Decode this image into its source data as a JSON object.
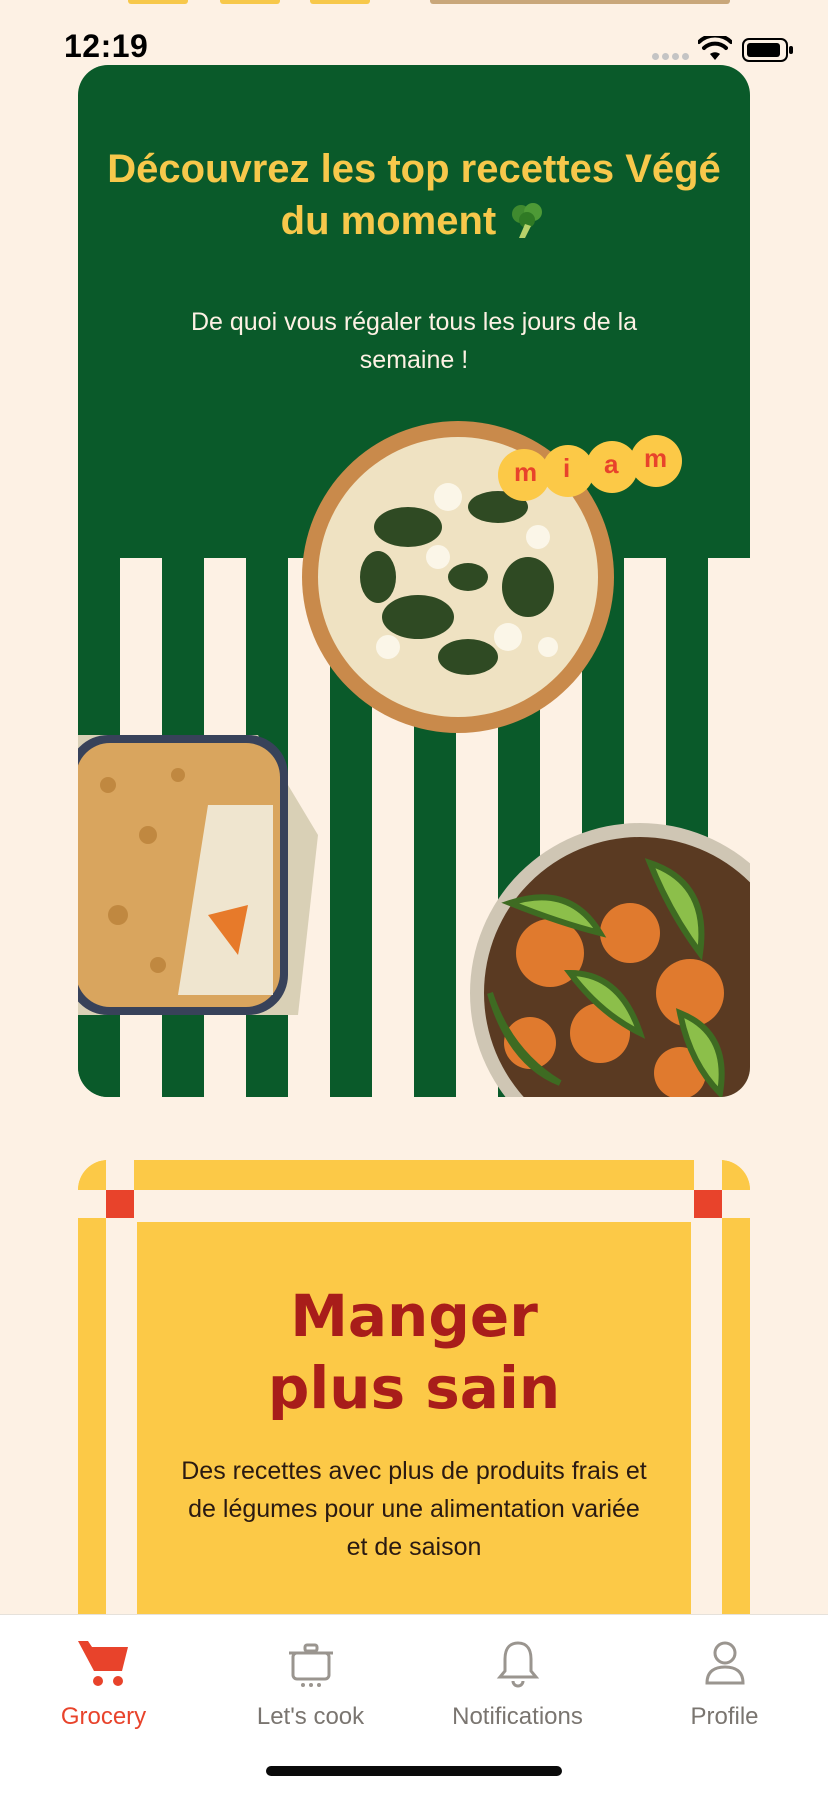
{
  "status_bar": {
    "time": "12:19"
  },
  "promo_vege": {
    "title": "Découvrez les top recettes Végé du moment",
    "subtitle": "De quoi vous régaler tous les jours de la semaine !",
    "sticker_letters": [
      "m",
      "i",
      "a",
      "m"
    ]
  },
  "promo_manger": {
    "title_line1": "Manger",
    "title_line2": "plus sain",
    "description": "Des recettes avec plus de produits frais et de légumes pour une alimentation variée et de saison"
  },
  "tab_bar": {
    "tabs": [
      {
        "label": "Grocery",
        "icon": "cart-icon",
        "active": true
      },
      {
        "label": "Let's cook",
        "icon": "pot-icon",
        "active": false
      },
      {
        "label": "Notifications",
        "icon": "bell-icon",
        "active": false
      },
      {
        "label": "Profile",
        "icon": "person-icon",
        "active": false
      }
    ]
  },
  "colors": {
    "background": "#fdf1e4",
    "vege_green": "#0a5a2a",
    "vege_title": "#f7c84b",
    "manger_yellow": "#fcc947",
    "manger_red": "#a81d1a",
    "accent": "#e8432b",
    "tab_inactive": "#7a7570"
  }
}
